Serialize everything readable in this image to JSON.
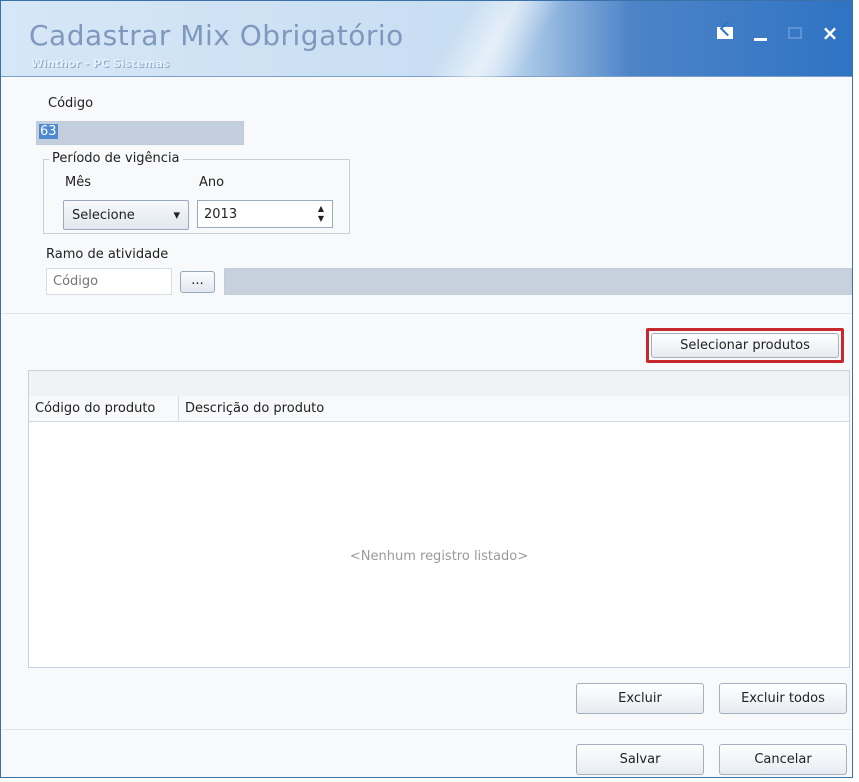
{
  "window": {
    "title": "Cadastrar Mix Obrigatório",
    "subtitle": "Winthor - PC Sistemas",
    "controls": {
      "restore_icon": "restore-icon",
      "minimize_icon": "minimize-icon",
      "maximize_icon": "maximize-icon",
      "close_icon": "close-icon",
      "close_symbol": "×"
    }
  },
  "form": {
    "codigo_label": "Código",
    "codigo_value": "63",
    "periodo_label": "Período de vigência",
    "mes_label": "Mês",
    "ano_label": "Ano",
    "mes_selected": "Selecione",
    "mes_arrow": "▾",
    "ano_value": "2013",
    "spin_up": "▲",
    "spin_down": "▼",
    "ramo_label": "Ramo de atividade",
    "ramo_codigo_placeholder": "Código",
    "ramo_lookup_button": "...",
    "ramo_description": ""
  },
  "products": {
    "select_button": "Selecionar produtos",
    "columns": [
      "Código do produto",
      "Descrição do produto"
    ],
    "empty_message": "<Nenhum registro listado>"
  },
  "actions": {
    "delete": "Excluir",
    "delete_all": "Excluir todos",
    "save": "Salvar",
    "cancel": "Cancelar"
  },
  "colors": {
    "titlebar_accent": "#2f73c4",
    "selection_blue": "#4f8ad1",
    "highlight_red": "#c6282e",
    "readonly_field": "#c7d1de"
  }
}
